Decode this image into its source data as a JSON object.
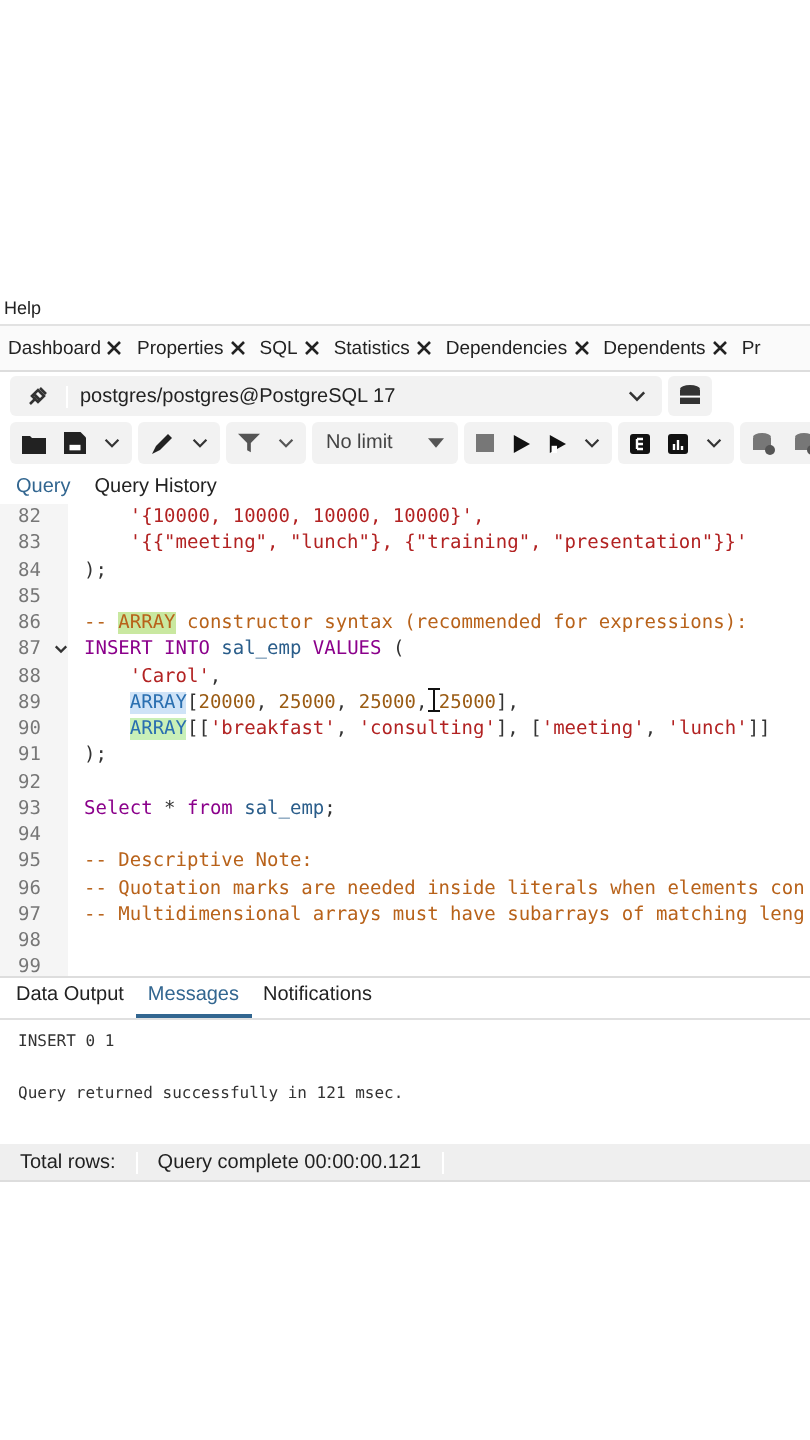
{
  "menu": {
    "label": "Help"
  },
  "tabs": [
    {
      "label": "Dashboard",
      "closable": true
    },
    {
      "label": "Properties",
      "closable": true
    },
    {
      "label": "SQL",
      "closable": true
    },
    {
      "label": "Statistics",
      "closable": true
    },
    {
      "label": "Dependencies",
      "closable": true
    },
    {
      "label": "Dependents",
      "closable": true
    },
    {
      "label": "Pr",
      "closable": false
    }
  ],
  "connection": {
    "value": "postgres/postgres@PostgreSQL 17"
  },
  "toolbar": {
    "row_limit": "No limit"
  },
  "query_tabs": [
    {
      "label": "Query",
      "selected": true
    },
    {
      "label": "Query History",
      "selected": false
    }
  ],
  "editor": {
    "lines": [
      {
        "number": "82",
        "fold": false,
        "indented": true,
        "tokens": [
          {
            "kind": "string",
            "text": "'{10000, 10000, 10000, 10000}',"
          }
        ]
      },
      {
        "number": "83",
        "fold": false,
        "indented": true,
        "tokens": [
          {
            "kind": "string",
            "text": "'{{\"meeting\", \"lunch\"}, {\"training\", \"presentation\"}}'"
          }
        ]
      },
      {
        "number": "84",
        "fold": false,
        "indented": false,
        "tokens": [
          {
            "kind": "plain",
            "text": ");"
          }
        ]
      },
      {
        "number": "85",
        "fold": false
      },
      {
        "number": "86",
        "fold": false,
        "indented": false,
        "tokens": [
          {
            "kind": "comment",
            "text": "-- "
          },
          {
            "kind": "comment_match",
            "text": "ARRAY"
          },
          {
            "kind": "comment",
            "text": " constructor syntax (recommended for expressions):"
          }
        ]
      },
      {
        "number": "87",
        "fold": true,
        "indented": false,
        "tokens": [
          {
            "kind": "keyword",
            "text": "INSERT INTO "
          },
          {
            "kind": "name",
            "text": "sal_emp"
          },
          {
            "kind": "keyword",
            "text": " VALUES"
          },
          {
            "kind": "plain",
            "text": " ("
          }
        ]
      },
      {
        "number": "88",
        "fold": false,
        "indented": true,
        "tokens": [
          {
            "kind": "string",
            "text": "'Carol'"
          },
          {
            "kind": "plain",
            "text": ","
          }
        ]
      },
      {
        "number": "89",
        "fold": false,
        "indented": true,
        "tokens": [
          {
            "kind": "array_selected",
            "text": "ARRAY"
          },
          {
            "kind": "plain",
            "text": "["
          },
          {
            "kind": "number",
            "text": "20000"
          },
          {
            "kind": "plain",
            "text": ", "
          },
          {
            "kind": "number",
            "text": "25000"
          },
          {
            "kind": "plain",
            "text": ", "
          },
          {
            "kind": "number",
            "text": "25000"
          },
          {
            "kind": "plain",
            "text": ", "
          },
          {
            "kind": "number",
            "text": "25000"
          },
          {
            "kind": "plain",
            "text": "],"
          }
        ]
      },
      {
        "number": "90",
        "fold": false,
        "indented": true,
        "tokens": [
          {
            "kind": "array_match",
            "text": "ARRAY"
          },
          {
            "kind": "plain",
            "text": "[["
          },
          {
            "kind": "string",
            "text": "'breakfast'"
          },
          {
            "kind": "plain",
            "text": ", "
          },
          {
            "kind": "string",
            "text": "'consulting'"
          },
          {
            "kind": "plain",
            "text": "], ["
          },
          {
            "kind": "string",
            "text": "'meeting'"
          },
          {
            "kind": "plain",
            "text": ", "
          },
          {
            "kind": "string",
            "text": "'lunch'"
          },
          {
            "kind": "plain",
            "text": "]]"
          }
        ]
      },
      {
        "number": "91",
        "fold": false,
        "indented": false,
        "tokens": [
          {
            "kind": "plain",
            "text": ");"
          }
        ]
      },
      {
        "number": "92",
        "fold": false
      },
      {
        "number": "93",
        "fold": false,
        "indented": false,
        "tokens": [
          {
            "kind": "keyword",
            "text": "Select"
          },
          {
            "kind": "plain",
            "text": " * "
          },
          {
            "kind": "keyword",
            "text": "from"
          },
          {
            "kind": "name",
            "text": " sal_emp"
          },
          {
            "kind": "plain",
            "text": ";"
          }
        ]
      },
      {
        "number": "94",
        "fold": false
      },
      {
        "number": "95",
        "fold": false,
        "indented": false,
        "tokens": [
          {
            "kind": "comment",
            "text": "-- Descriptive Note:"
          }
        ]
      },
      {
        "number": "96",
        "fold": false,
        "indented": false,
        "tokens": [
          {
            "kind": "comment",
            "text": "-- Quotation marks are needed inside literals when elements con"
          }
        ]
      },
      {
        "number": "97",
        "fold": false,
        "indented": false,
        "tokens": [
          {
            "kind": "comment",
            "text": "-- Multidimensional arrays must have subarrays of matching leng"
          }
        ]
      },
      {
        "number": "98",
        "fold": false
      },
      {
        "number": "99",
        "fold": false
      }
    ]
  },
  "result_tabs": [
    {
      "label": "Data Output",
      "selected": false
    },
    {
      "label": "Messages",
      "selected": true
    },
    {
      "label": "Notifications",
      "selected": false
    }
  ],
  "messages": [
    "INSERT 0 1",
    "Query returned successfully in 121 msec."
  ],
  "status_bar": {
    "total_rows": "Total rows:",
    "status": "Query complete 00:00:00.121"
  }
}
